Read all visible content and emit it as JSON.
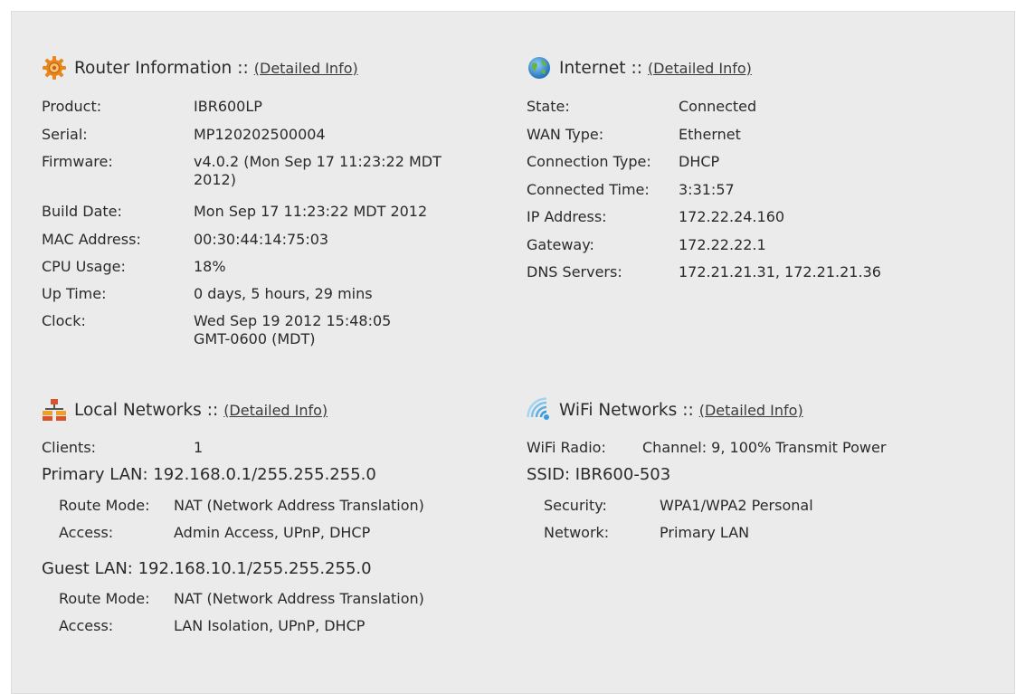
{
  "router": {
    "title": "Router Information",
    "sep": "::",
    "link": "(Detailed Info)",
    "rows": [
      {
        "label": "Product:",
        "value": "IBR600LP"
      },
      {
        "label": "Serial:",
        "value": "MP120202500004"
      },
      {
        "label": "Firmware:",
        "value": "v4.0.2 (Mon Sep 17 11:23:22 MDT 2012)"
      },
      {
        "label": "Build Date:",
        "value": "Mon Sep 17 11:23:22 MDT 2012"
      },
      {
        "label": "MAC Address:",
        "value": "00:30:44:14:75:03"
      },
      {
        "label": "CPU Usage:",
        "value": "18%"
      },
      {
        "label": "Up Time:",
        "value": "0 days, 5 hours, 29 mins"
      },
      {
        "label": "Clock:",
        "value": "Wed Sep 19 2012 15:48:05 GMT-0600 (MDT)"
      }
    ]
  },
  "internet": {
    "title": "Internet",
    "sep": "::",
    "link": "(Detailed Info)",
    "rows": [
      {
        "label": "State:",
        "value": "Connected"
      },
      {
        "label": "WAN Type:",
        "value": "Ethernet"
      },
      {
        "label": "Connection Type:",
        "value": "DHCP"
      },
      {
        "label": "Connected Time:",
        "value": "3:31:57"
      },
      {
        "label": "IP Address:",
        "value": "172.22.24.160"
      },
      {
        "label": "Gateway:",
        "value": "172.22.22.1"
      },
      {
        "label": "DNS Servers:",
        "value": "172.21.21.31, 172.21.21.36"
      }
    ]
  },
  "local": {
    "title": "Local Networks",
    "sep": "::",
    "link": "(Detailed Info)",
    "clients_label": "Clients:",
    "clients_value": "1",
    "primary_lan": "Primary LAN: 192.168.0.1/255.255.255.0",
    "primary_rows": [
      {
        "label": "Route Mode:",
        "value": "NAT (Network Address Translation)"
      },
      {
        "label": "Access:",
        "value": "Admin Access, UPnP, DHCP"
      }
    ],
    "guest_lan": "Guest LAN: 192.168.10.1/255.255.255.0",
    "guest_rows": [
      {
        "label": "Route Mode:",
        "value": "NAT (Network Address Translation)"
      },
      {
        "label": "Access:",
        "value": "LAN Isolation, UPnP, DHCP"
      }
    ]
  },
  "wifi": {
    "title": "WiFi Networks",
    "sep": "::",
    "link": "(Detailed Info)",
    "radio_label": "WiFi Radio:",
    "radio_value": "Channel: 9, 100% Transmit Power",
    "ssid": "SSID: IBR600-503",
    "rows": [
      {
        "label": "Security:",
        "value": "WPA1/WPA2 Personal"
      },
      {
        "label": "Network:",
        "value": "Primary LAN"
      }
    ]
  },
  "icons": {
    "router": "gear-icon",
    "internet": "globe-icon",
    "local": "network-icon",
    "wifi": "wifi-icon"
  },
  "colors": {
    "panel_bg": "#ebebeb",
    "text": "#2a2a2a",
    "gear_orange": "#e8861a",
    "globe_blue": "#2a7fc4",
    "globe_green": "#6ab43a",
    "network_red": "#d9532a",
    "network_orange": "#f0a028",
    "wifi_blue": "#3a9be0"
  }
}
